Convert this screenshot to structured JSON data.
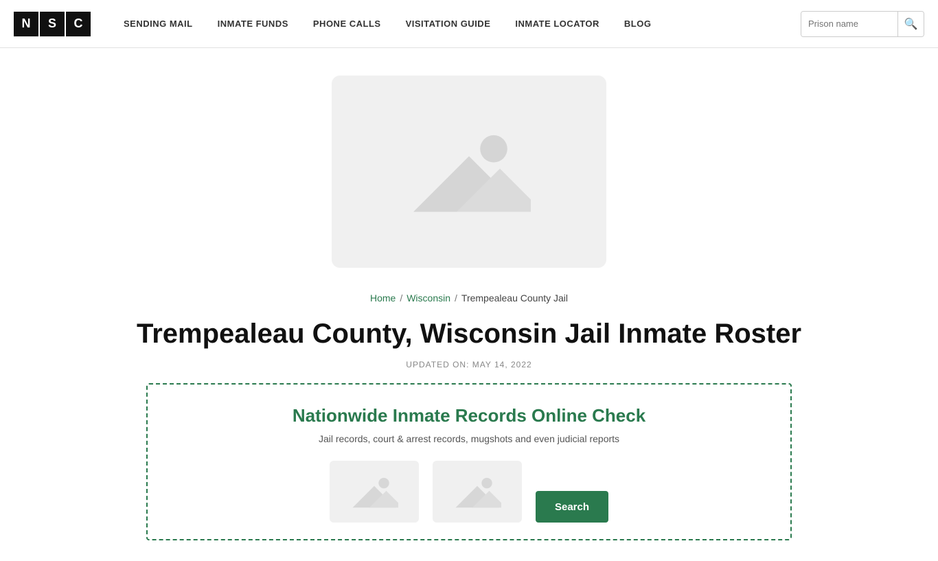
{
  "logo": {
    "letters": [
      "N",
      "S",
      "C"
    ]
  },
  "nav": {
    "items": [
      {
        "label": "SENDING MAIL",
        "href": "#"
      },
      {
        "label": "INMATE FUNDS",
        "href": "#"
      },
      {
        "label": "PHONE CALLS",
        "href": "#"
      },
      {
        "label": "VISITATION GUIDE",
        "href": "#"
      },
      {
        "label": "INMATE LOCATOR",
        "href": "#"
      },
      {
        "label": "BLOG",
        "href": "#"
      }
    ]
  },
  "search": {
    "placeholder": "Prison name"
  },
  "breadcrumb": {
    "home": "Home",
    "separator1": "/",
    "state": "Wisconsin",
    "separator2": "/",
    "current": "Trempealeau County Jail"
  },
  "page": {
    "title": "Trempealeau County, Wisconsin Jail Inmate Roster",
    "updated_label": "UPDATED ON: MAY 14, 2022"
  },
  "records_card": {
    "title": "Nationwide Inmate Records Online Check",
    "description": "Jail records, court & arrest records, mugshots and even judicial reports",
    "search_button_label": "Search"
  }
}
